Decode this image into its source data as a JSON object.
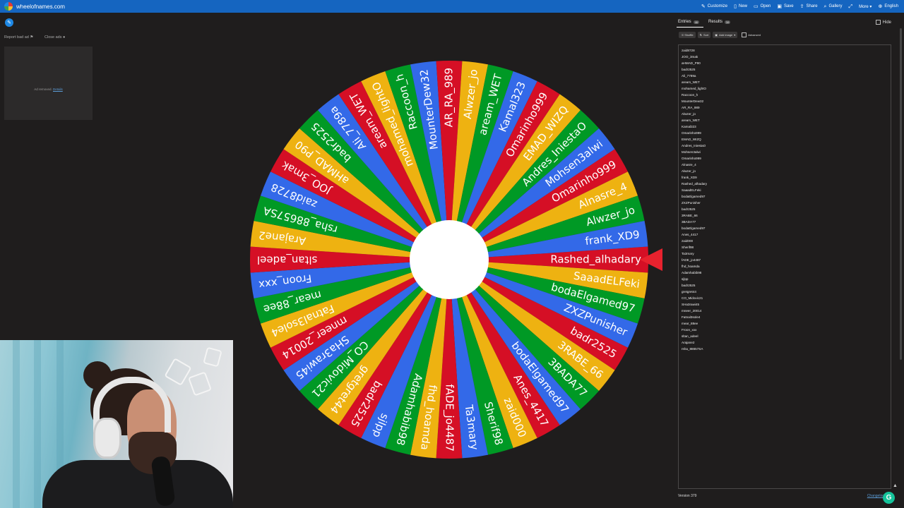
{
  "site": {
    "domain": "wheelofnames.com"
  },
  "menu": [
    {
      "label": "Customize",
      "icon": "palette-icon",
      "glyph": "✎"
    },
    {
      "label": "New",
      "icon": "file-icon",
      "glyph": "▯"
    },
    {
      "label": "Open",
      "icon": "folder-icon",
      "glyph": "▭"
    },
    {
      "label": "Save",
      "icon": "save-icon",
      "glyph": "▣"
    },
    {
      "label": "Share",
      "icon": "share-icon",
      "glyph": "⇪"
    },
    {
      "label": "Gallery",
      "icon": "search-icon",
      "glyph": "⌕"
    },
    {
      "label": "",
      "icon": "fullscreen-icon",
      "glyph": "⤢"
    },
    {
      "label": "More ▾",
      "icon": "more-icon",
      "glyph": ""
    },
    {
      "label": "English",
      "icon": "globe-icon",
      "glyph": "⊕"
    }
  ],
  "left": {
    "report_ad": "Report bad ad",
    "close_ads": "Close ads",
    "ad_removed": "Ad removed.",
    "ad_details": "Details"
  },
  "wheel": {
    "colors": [
      "#3369e8",
      "#d50f25",
      "#eeb211",
      "#009925"
    ],
    "center_color": "#ffffff",
    "pointer_color": "#e8222e",
    "selected": "Rashed_alhadary"
  },
  "panel": {
    "tab_entries": "Entries",
    "tab_entries_count": "46",
    "tab_results": "Results",
    "tab_results_count": "38",
    "hide": "Hide",
    "shuffle": "Shuffle",
    "sort": "Sort",
    "add_image": "Add image",
    "advanced": "Advanced",
    "version": "Version 379",
    "changelog": "Changelog"
  },
  "entries": [
    "zaid8728",
    "JOO_3mak",
    "aHMAD_P90",
    "badr2525",
    "Ali_7789a",
    "aream_WET",
    "mohamed_lightO",
    "Raccoon_h",
    "MounterDew32",
    "AR_RA_989",
    "Alwzer_jo",
    "aream_WET",
    "Kamal323",
    "Omarinho999",
    "EMAD_WIZQ",
    "Andres_IniestaO",
    "Mohsen3alwi",
    "Omarinho999",
    "Alnasre_4",
    "Alwzer_jo",
    "frank_XD9",
    "Rashed_alhadary",
    "SaaadELFeki",
    "bodaElgamed97",
    "ZXZPunisher",
    "badr2525",
    "3RABE_66",
    "3BADA77",
    "bodaElgamed97",
    "Anes_4417",
    "zaid000",
    "Sherif98",
    "Ta3mary",
    "fADE_jo4487",
    "fhd_hoamda",
    "Adamhabib98",
    "sjlpp",
    "badr2525",
    "gretgret44",
    "CO_Midovic21",
    "SHa3rawi45",
    "mneer_20014",
    "Fatnal3sole4",
    "mear_88ee",
    "Froon_xxx",
    "sltan_adeel",
    "Arajane2",
    "rsha_88657SA"
  ],
  "wheel_labels": [
    "Rashed_alhadary",
    "SaaadELFeki",
    "bodaElgamed97",
    "ZXZPunisher",
    "badr2525",
    "3RABE_66",
    "3BADA77",
    "bodaElgamed97",
    "Anes_4417",
    "zaid000",
    "Sherif98",
    "Ta3mary",
    "fADE_jo4487",
    "fhd_hoamda",
    "Adamhabib98",
    "sjlpp",
    "badr2525",
    "gretgret44",
    "CO_Midovic21",
    "SHa3rawi45",
    "mneer_20014",
    "Fatnal3sole4",
    "mear_88ee",
    "Froon_xxx",
    "sltan_adeel",
    "Arajane2",
    "rsha_88657SA",
    "zaid8728",
    "JOO_3mak",
    "aHMAD_P90",
    "badr2525",
    "Ali_7789a",
    "aream_WET",
    "mohamed_lightO",
    "Raccoon_h",
    "MounterDew32",
    "AR_RA_989",
    "Alwzer_jo",
    "aream_WET",
    "Kamal323",
    "Omarinho999",
    "EMAD_WIZQ",
    "Andres_IniestaO",
    "Mohsen3alwi",
    "Omarinho999",
    "Alnasre_4",
    "Alwzer_jo",
    "frank_XD9"
  ]
}
